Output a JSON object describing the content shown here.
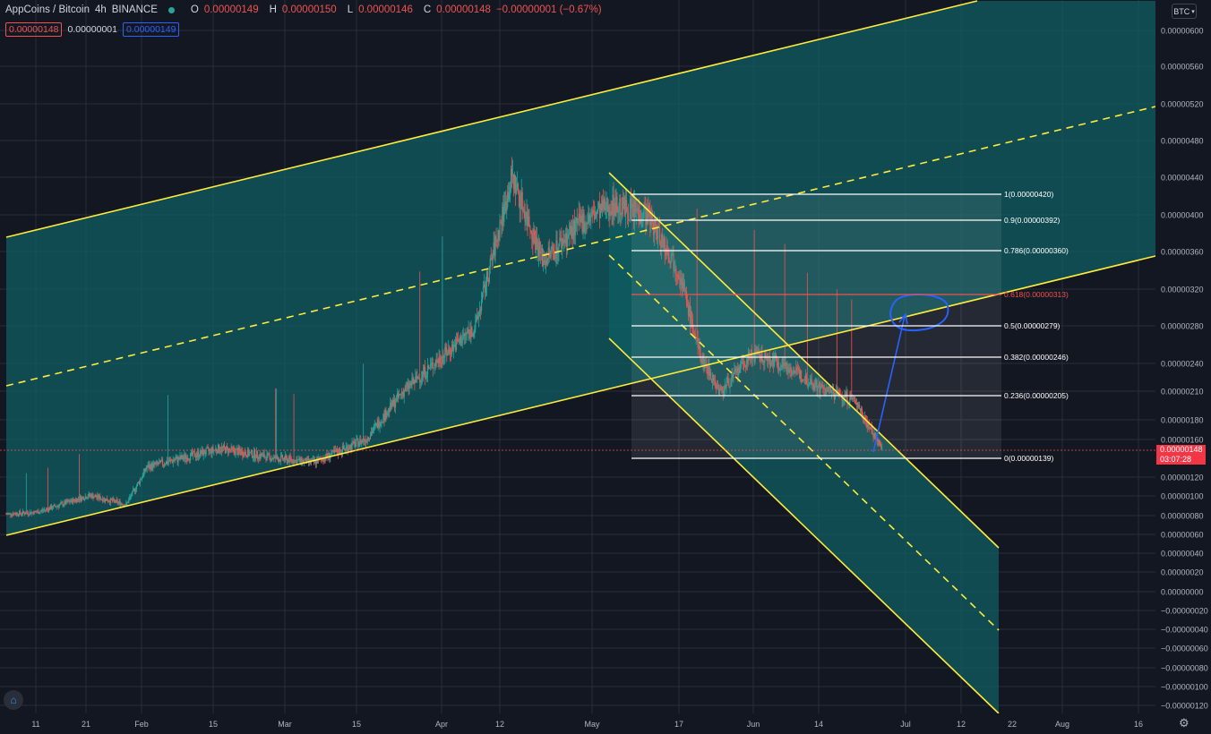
{
  "header": {
    "symbol": "AppCoins / Bitcoin",
    "interval": "4h",
    "exchange": "BINANCE",
    "open_label": "O",
    "open": "0.00000149",
    "high_label": "H",
    "high": "0.00000150",
    "low_label": "L",
    "low": "0.00000146",
    "close_label": "C",
    "close": "0.00000148",
    "change": "−0.00000001 (−0.67%)"
  },
  "spread": {
    "bid": "0.00000148",
    "spread": "0.00000001",
    "ask": "0.00000149"
  },
  "currency_button": "BTC",
  "current_price": {
    "value": "0.00000148",
    "countdown": "03:07:28"
  },
  "colors": {
    "background": "#131722",
    "channel": "#ffeb3b",
    "fill": "#0f5e62",
    "up": "#26a69a",
    "down": "#ef5350",
    "fib": "#ffffff",
    "fib_618": "#ef5350",
    "annotation": "#2962ff"
  },
  "chart_data": {
    "type": "candlestick",
    "symbol": "AppCoins / Bitcoin",
    "timeframe": "4h",
    "y_axis": {
      "ticks": [
        "0.00000600",
        "0.00000560",
        "0.00000520",
        "0.00000480",
        "0.00000440",
        "0.00000400",
        "0.00000360",
        "0.00000320",
        "0.00000280",
        "0.00000240",
        "0.00000210",
        "0.00000180",
        "0.00000160",
        "0.00000120",
        "0.00000100",
        "0.00000080",
        "0.00000060",
        "0.00000040",
        "0.00000020",
        "0.00000000",
        "−0.00000020",
        "−0.00000040",
        "−0.00000060",
        "−0.00000080",
        "−0.00000100",
        "−0.00000120"
      ]
    },
    "x_axis": {
      "ticks": [
        "11",
        "21",
        "Feb",
        "15",
        "Mar",
        "15",
        "Apr",
        "12",
        "May",
        "17",
        "Jun",
        "14",
        "Jul",
        "12",
        "Aug",
        "16",
        "22"
      ]
    },
    "price_path": [
      [
        "Jan 5",
        8e-07
      ],
      [
        "Jan 11",
        8.2e-07
      ],
      [
        "Jan 21",
        1e-06
      ],
      [
        "Jan 28",
        9e-07
      ],
      [
        "Feb 1",
        1.3e-06
      ],
      [
        "Feb 8",
        1.4e-06
      ],
      [
        "Feb 15",
        1.5e-06
      ],
      [
        "Feb 25",
        1.4e-06
      ],
      [
        "Mar 5",
        1.35e-06
      ],
      [
        "Mar 15",
        1.6e-06
      ],
      [
        "Mar 22",
        2.1e-06
      ],
      [
        "Mar 30",
        2.5e-06
      ],
      [
        "Apr 5",
        2.8e-06
      ],
      [
        "Apr 12",
        4.4e-06
      ],
      [
        "Apr 18",
        3.5e-06
      ],
      [
        "Apr 25",
        3.9e-06
      ],
      [
        "May 1",
        4.1e-06
      ],
      [
        "May 8",
        4e-06
      ],
      [
        "May 14",
        3.4e-06
      ],
      [
        "May 18",
        2.5e-06
      ],
      [
        "May 22",
        2.1e-06
      ],
      [
        "May 28",
        2.5e-06
      ],
      [
        "Jun 3",
        2.4e-06
      ],
      [
        "Jun 10",
        2.15e-06
      ],
      [
        "Jun 17",
        2e-06
      ],
      [
        "Jun 22",
        1.48e-06
      ]
    ],
    "fibonacci": [
      {
        "ratio": "1",
        "value": "0.00000420"
      },
      {
        "ratio": "0.9",
        "value": "0.00000392"
      },
      {
        "ratio": "0.786",
        "value": "0.00000360"
      },
      {
        "ratio": "0.618",
        "value": "0.00000313"
      },
      {
        "ratio": "0.5",
        "value": "0.00000279"
      },
      {
        "ratio": "0.382",
        "value": "0.00000246"
      },
      {
        "ratio": "0.236",
        "value": "0.00000205"
      },
      {
        "ratio": "0",
        "value": "0.00000139"
      }
    ],
    "last_price": "0.00000148"
  }
}
